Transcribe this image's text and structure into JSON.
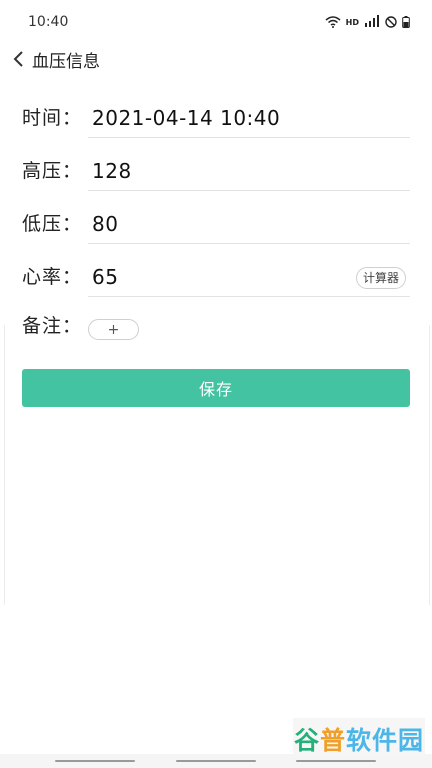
{
  "status_bar": {
    "time": "10:40",
    "network_hd": "HD",
    "network_signal": "4G",
    "icons": [
      "wifi-icon",
      "hd-icon",
      "signal-icon",
      "do-not-disturb-icon",
      "battery-icon"
    ]
  },
  "header": {
    "back_icon": "chevron-left-icon",
    "title": "血压信息"
  },
  "form": {
    "time": {
      "label": "时间：",
      "value": "2021-04-14 10:40"
    },
    "systolic": {
      "label": "高压：",
      "value": "128"
    },
    "diastolic": {
      "label": "低压：",
      "value": "80"
    },
    "heart_rate": {
      "label": "心率：",
      "value": "65",
      "calculator_label": "计算器"
    },
    "note": {
      "label": "备注：",
      "add_label": "+"
    }
  },
  "save_label": "保存",
  "colors": {
    "accent": "#43c3a2"
  },
  "watermark": {
    "part1": "谷",
    "part2": "普",
    "part3": "软件园"
  }
}
